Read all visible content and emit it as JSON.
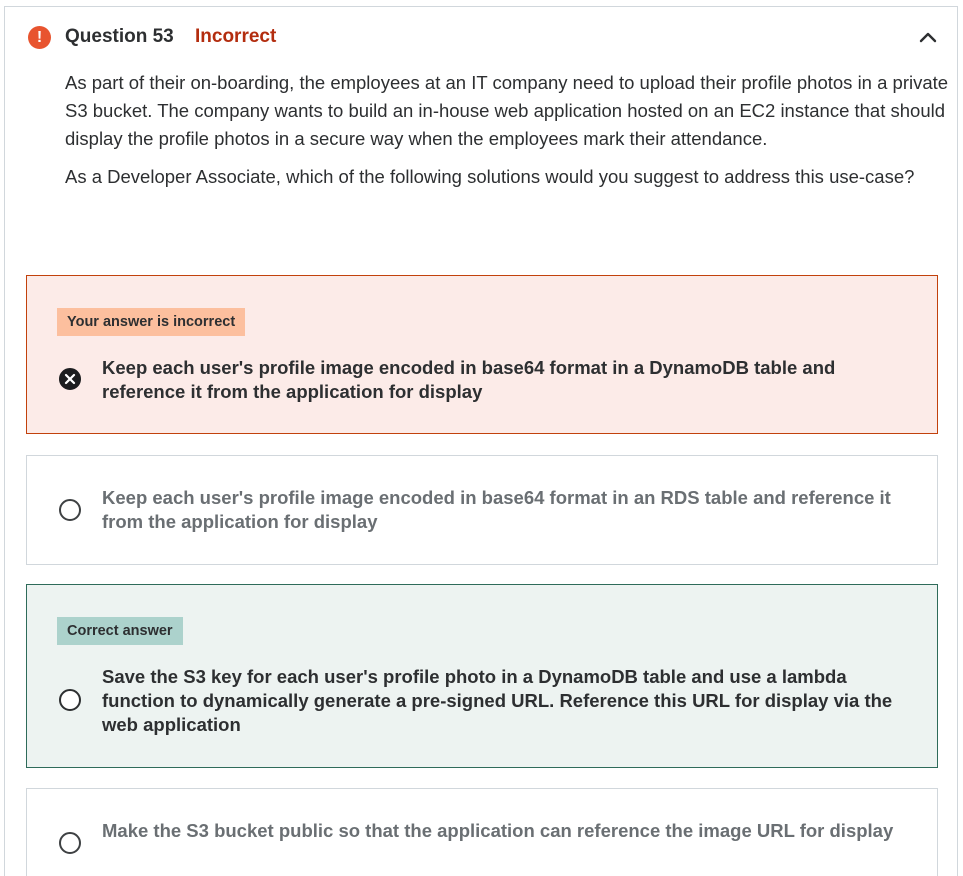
{
  "question": {
    "title": "Question 53",
    "status": "Incorrect",
    "paragraphs": [
      "As part of their on-boarding, the employees at an IT company need to upload their profile photos in a private S3 bucket. The company wants to build an in-house web application hosted on an EC2 instance that should display the profile photos in a secure way when the employees mark their attendance.",
      "As a Developer Associate, which of the following solutions would you suggest to address this use-case?"
    ]
  },
  "options": [
    {
      "tag": "Your answer is incorrect",
      "text": "Keep each user's profile image encoded in base64 format in a DynamoDB table and reference it from the application for display",
      "state": "incorrect"
    },
    {
      "tag": "",
      "text": "Keep each user's profile image encoded in base64 format in an RDS table and reference it from the application for display",
      "state": "neutral"
    },
    {
      "tag": "Correct answer",
      "text": "Save the S3 key for each user's profile photo in a DynamoDB table and use a lambda function to dynamically generate a pre-signed URL. Reference this URL for display via the web application",
      "state": "correct"
    },
    {
      "tag": "",
      "text": "Make the S3 bucket public so that the application can reference the image URL for display",
      "state": "neutral"
    }
  ],
  "icons": {
    "status": "exclamation-circle-icon",
    "collapse": "chevron-up-icon",
    "selected_wrong": "x-circle-icon",
    "radio": "radio-circle-icon"
  },
  "colors": {
    "incorrect_accent": "#b32d0f",
    "incorrect_bg": "#fcebe8",
    "incorrect_tag": "#fcbf9e",
    "correct_bg": "#edf3f1",
    "correct_tag": "#acd2cc",
    "correct_border": "#2e6b5a"
  }
}
